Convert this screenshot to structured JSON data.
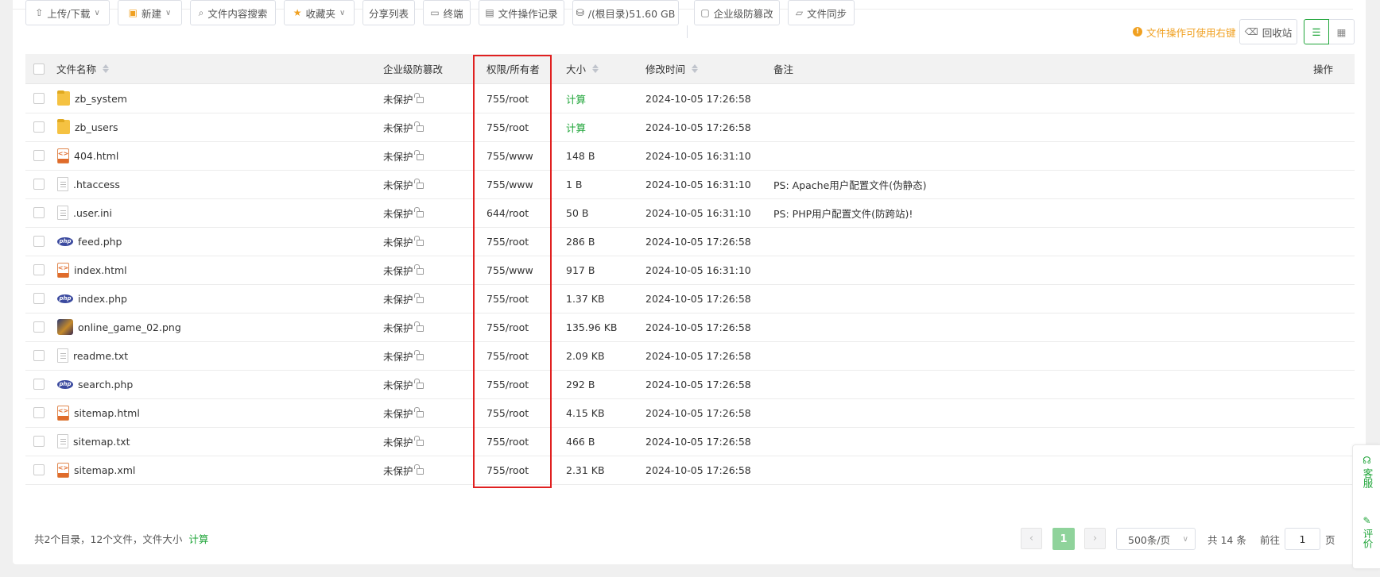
{
  "toolbar": {
    "upload_download": "上传/下载",
    "new": "新建",
    "content_search": "文件内容搜索",
    "favorites": "收藏夹",
    "share_list": "分享列表",
    "terminal": "终端",
    "op_log": "文件操作记录",
    "disk": "/(根目录)51.60 GB",
    "tamper_proof": "企业级防篡改",
    "file_sync": "文件同步",
    "tip": "文件操作可使用右键",
    "recycle_bin": "回收站"
  },
  "table": {
    "headers": {
      "name": "文件名称",
      "protect": "企业级防篡改",
      "perm": "权限/所有者",
      "size": "大小",
      "mtime": "修改时间",
      "remark": "备注",
      "ops": "操作"
    },
    "rows": [
      {
        "icon": "folder-icon",
        "name": "zb_system",
        "protect": "未保护",
        "perm": "755/root",
        "size": "计算",
        "size_is_link": true,
        "mtime": "2024-10-05 17:26:58",
        "remark": ""
      },
      {
        "icon": "folder-icon",
        "name": "zb_users",
        "protect": "未保护",
        "perm": "755/root",
        "size": "计算",
        "size_is_link": true,
        "mtime": "2024-10-05 17:26:58",
        "remark": ""
      },
      {
        "icon": "html-file-icon",
        "name": "404.html",
        "protect": "未保护",
        "perm": "755/www",
        "size": "148 B",
        "mtime": "2024-10-05 16:31:10",
        "remark": ""
      },
      {
        "icon": "text-file-icon",
        "name": ".htaccess",
        "protect": "未保护",
        "perm": "755/www",
        "size": "1 B",
        "mtime": "2024-10-05 16:31:10",
        "remark": "PS: Apache用户配置文件(伪静态)"
      },
      {
        "icon": "text-file-icon",
        "name": ".user.ini",
        "protect": "未保护",
        "perm": "644/root",
        "size": "50 B",
        "mtime": "2024-10-05 16:31:10",
        "remark": "PS: PHP用户配置文件(防跨站)!"
      },
      {
        "icon": "php-file-icon",
        "name": "feed.php",
        "protect": "未保护",
        "perm": "755/root",
        "size": "286 B",
        "mtime": "2024-10-05 17:26:58",
        "remark": ""
      },
      {
        "icon": "html-file-icon",
        "name": "index.html",
        "protect": "未保护",
        "perm": "755/www",
        "size": "917 B",
        "mtime": "2024-10-05 16:31:10",
        "remark": ""
      },
      {
        "icon": "php-file-icon",
        "name": "index.php",
        "protect": "未保护",
        "perm": "755/root",
        "size": "1.37 KB",
        "mtime": "2024-10-05 17:26:58",
        "remark": ""
      },
      {
        "icon": "image-thumbnail-icon",
        "name": "online_game_02.png",
        "protect": "未保护",
        "perm": "755/root",
        "size": "135.96 KB",
        "mtime": "2024-10-05 17:26:58",
        "remark": ""
      },
      {
        "icon": "text-file-icon",
        "name": "readme.txt",
        "protect": "未保护",
        "perm": "755/root",
        "size": "2.09 KB",
        "mtime": "2024-10-05 17:26:58",
        "remark": ""
      },
      {
        "icon": "php-file-icon",
        "name": "search.php",
        "protect": "未保护",
        "perm": "755/root",
        "size": "292 B",
        "mtime": "2024-10-05 17:26:58",
        "remark": ""
      },
      {
        "icon": "html-file-icon",
        "name": "sitemap.html",
        "protect": "未保护",
        "perm": "755/root",
        "size": "4.15 KB",
        "mtime": "2024-10-05 17:26:58",
        "remark": ""
      },
      {
        "icon": "text-file-icon",
        "name": "sitemap.txt",
        "protect": "未保护",
        "perm": "755/root",
        "size": "466 B",
        "mtime": "2024-10-05 17:26:58",
        "remark": ""
      },
      {
        "icon": "xml-file-icon",
        "name": "sitemap.xml",
        "protect": "未保护",
        "perm": "755/root",
        "size": "2.31 KB",
        "mtime": "2024-10-05 17:26:58",
        "remark": ""
      }
    ]
  },
  "footer": {
    "summary": "共2个目录，12个文件，文件大小",
    "calc": "计算",
    "current_page": "1",
    "page_size": "500条/页",
    "total": "共 14 条",
    "goto_prefix": "前往",
    "goto_value": "1",
    "goto_suffix": "页"
  },
  "side": {
    "service": "客服",
    "review": "评价"
  },
  "colors": {
    "accent": "#20a53a",
    "warning": "#f0a020",
    "highlight_border": "#e02020"
  }
}
